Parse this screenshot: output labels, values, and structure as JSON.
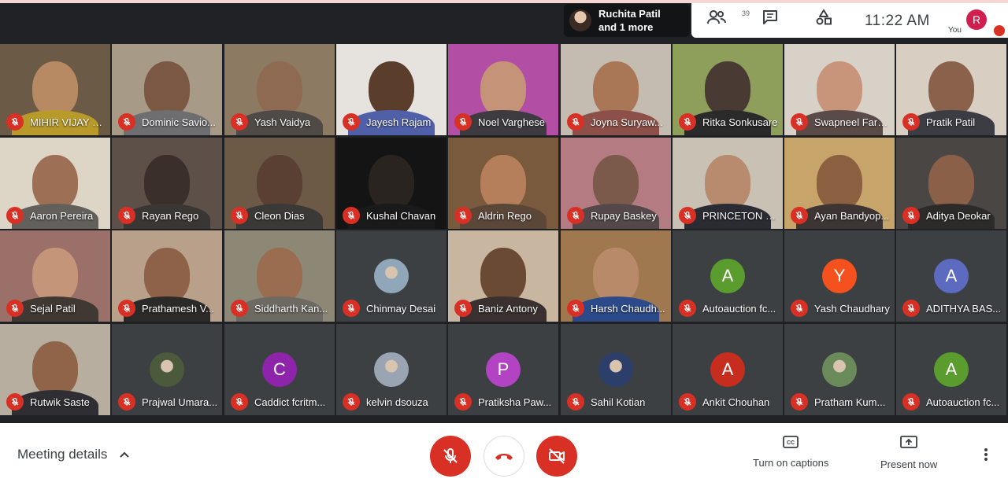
{
  "active_speaker": {
    "line1": "Ruchita Patil",
    "line2": "and 1 more"
  },
  "header": {
    "participant_count": "39",
    "time": "11:22 AM",
    "self_initial": "R",
    "self_label": "You"
  },
  "tiles": [
    {
      "name": "MIHIR VIJAY B...",
      "video": true,
      "bg": "#6b5a46",
      "skin": "#b88a64",
      "shirt": "#b79a2a"
    },
    {
      "name": "Dominic Savio...",
      "video": true,
      "bg": "#a79a87",
      "skin": "#7a5844",
      "shirt": "#6e6d70"
    },
    {
      "name": "Yash Vaidya",
      "video": true,
      "bg": "#8c7a62",
      "skin": "#8f6a52",
      "shirt": "#4f4a46"
    },
    {
      "name": "Jayesh Rajam",
      "video": true,
      "bg": "#e6e3df",
      "skin": "#5b3d2b",
      "shirt": "#5060a8"
    },
    {
      "name": "Noel Varghese",
      "video": true,
      "bg": "#b24fa5",
      "skin": "#c49378",
      "shirt": "#3d3b3f"
    },
    {
      "name": "Joyna Suryaw...",
      "video": true,
      "bg": "#c4bcb0",
      "skin": "#a97656",
      "shirt": "#8c5048"
    },
    {
      "name": "Ritka Sonkusare",
      "video": true,
      "bg": "#8e9f5c",
      "skin": "#4a3a34",
      "shirt": "#2a2a2a"
    },
    {
      "name": "Swapneel Farg...",
      "video": true,
      "bg": "#d7d1c8",
      "skin": "#c8957a",
      "shirt": "#5a4a48"
    },
    {
      "name": "Pratik Patil",
      "video": true,
      "bg": "#d8cfc2",
      "skin": "#8a624b",
      "shirt": "#3c3c44"
    },
    {
      "name": "Aaron Pereira",
      "video": true,
      "bg": "#ddd5c6",
      "skin": "#9d7055",
      "shirt": "#63605c"
    },
    {
      "name": "Rayan Rego",
      "video": true,
      "bg": "#5c5048",
      "skin": "#3b2f2a",
      "shirt": "#3a3633"
    },
    {
      "name": "Cleon Dias",
      "video": true,
      "bg": "#6c5a47",
      "skin": "#5a4032",
      "shirt": "#3b3936"
    },
    {
      "name": "Kushal Chavan",
      "video": true,
      "bg": "#141414",
      "skin": "#2a2420",
      "shirt": "#1a1a1a"
    },
    {
      "name": "Aldrin Rego",
      "video": true,
      "bg": "#7a5a3c",
      "skin": "#b47f5a",
      "shirt": "#5b4738"
    },
    {
      "name": "Rupay Baskey",
      "video": true,
      "bg": "#b57b82",
      "skin": "#7c5a4b",
      "shirt": "#54484a"
    },
    {
      "name": "PRINCETON D...",
      "video": true,
      "bg": "#c9c1b4",
      "skin": "#b88b6f",
      "shirt": "#2b2b33"
    },
    {
      "name": "Ayan Bandyop...",
      "video": true,
      "bg": "#c6a46a",
      "skin": "#8a6040",
      "shirt": "#3d3534"
    },
    {
      "name": "Aditya Deokar",
      "video": true,
      "bg": "#4a4643",
      "skin": "#8a6148",
      "shirt": "#2c2b2a"
    },
    {
      "name": "Sejal Patil",
      "video": true,
      "bg": "#9a7068",
      "skin": "#c59579",
      "shirt": "#3f3833"
    },
    {
      "name": "Prathamesh V...",
      "video": true,
      "bg": "#b9a08b",
      "skin": "#8d6248",
      "shirt": "#2c2a29"
    },
    {
      "name": "Siddharth Kan...",
      "video": true,
      "bg": "#8d8775",
      "skin": "#9a6c50",
      "shirt": "#6d6a63"
    },
    {
      "name": "Chinmay Desai",
      "video": false,
      "pic": "#8fa7b8"
    },
    {
      "name": "Baniz Antony",
      "video": true,
      "bg": "#c8b6a0",
      "skin": "#6a4a34",
      "shirt": "#3a3030"
    },
    {
      "name": "Harsh Chaudh...",
      "video": true,
      "bg": "#a07850",
      "skin": "#b88a6a",
      "shirt": "#2c4a8a"
    },
    {
      "name": "Autoauction fc...",
      "video": false,
      "initial": "A",
      "color": "#5a9c2e"
    },
    {
      "name": "Yash Chaudhary",
      "video": false,
      "initial": "Y",
      "color": "#f4511e"
    },
    {
      "name": "ADITHYA BAS...",
      "video": false,
      "initial": "A",
      "color": "#5c6bc0"
    },
    {
      "name": "Rutwik Saste",
      "video": true,
      "bg": "#b8ae9f",
      "skin": "#8f6449",
      "shirt": "#2e2e33"
    },
    {
      "name": "Prajwal Umara...",
      "video": false,
      "pic": "#4b5a3a"
    },
    {
      "name": "Caddict fcritm...",
      "video": false,
      "initial": "C",
      "color": "#8e24aa"
    },
    {
      "name": "kelvin dsouza",
      "video": false,
      "pic": "#9aa4b2"
    },
    {
      "name": "Pratiksha Paw...",
      "video": false,
      "initial": "P",
      "color": "#b244c4"
    },
    {
      "name": "Sahil Kotian",
      "video": false,
      "pic": "#2c3e6a"
    },
    {
      "name": "Ankit Chouhan",
      "video": false,
      "initial": "A",
      "color": "#c62d1f"
    },
    {
      "name": "Pratham Kum...",
      "video": false,
      "pic": "#6a8a5a"
    },
    {
      "name": "Autoauction fc...",
      "video": false,
      "initial": "A",
      "color": "#5a9c2e"
    }
  ],
  "bottom": {
    "meeting_details": "Meeting details",
    "captions_label": "Turn on captions",
    "present_label": "Present now"
  },
  "colors": {
    "red": "#d93025",
    "bg": "#202124"
  }
}
